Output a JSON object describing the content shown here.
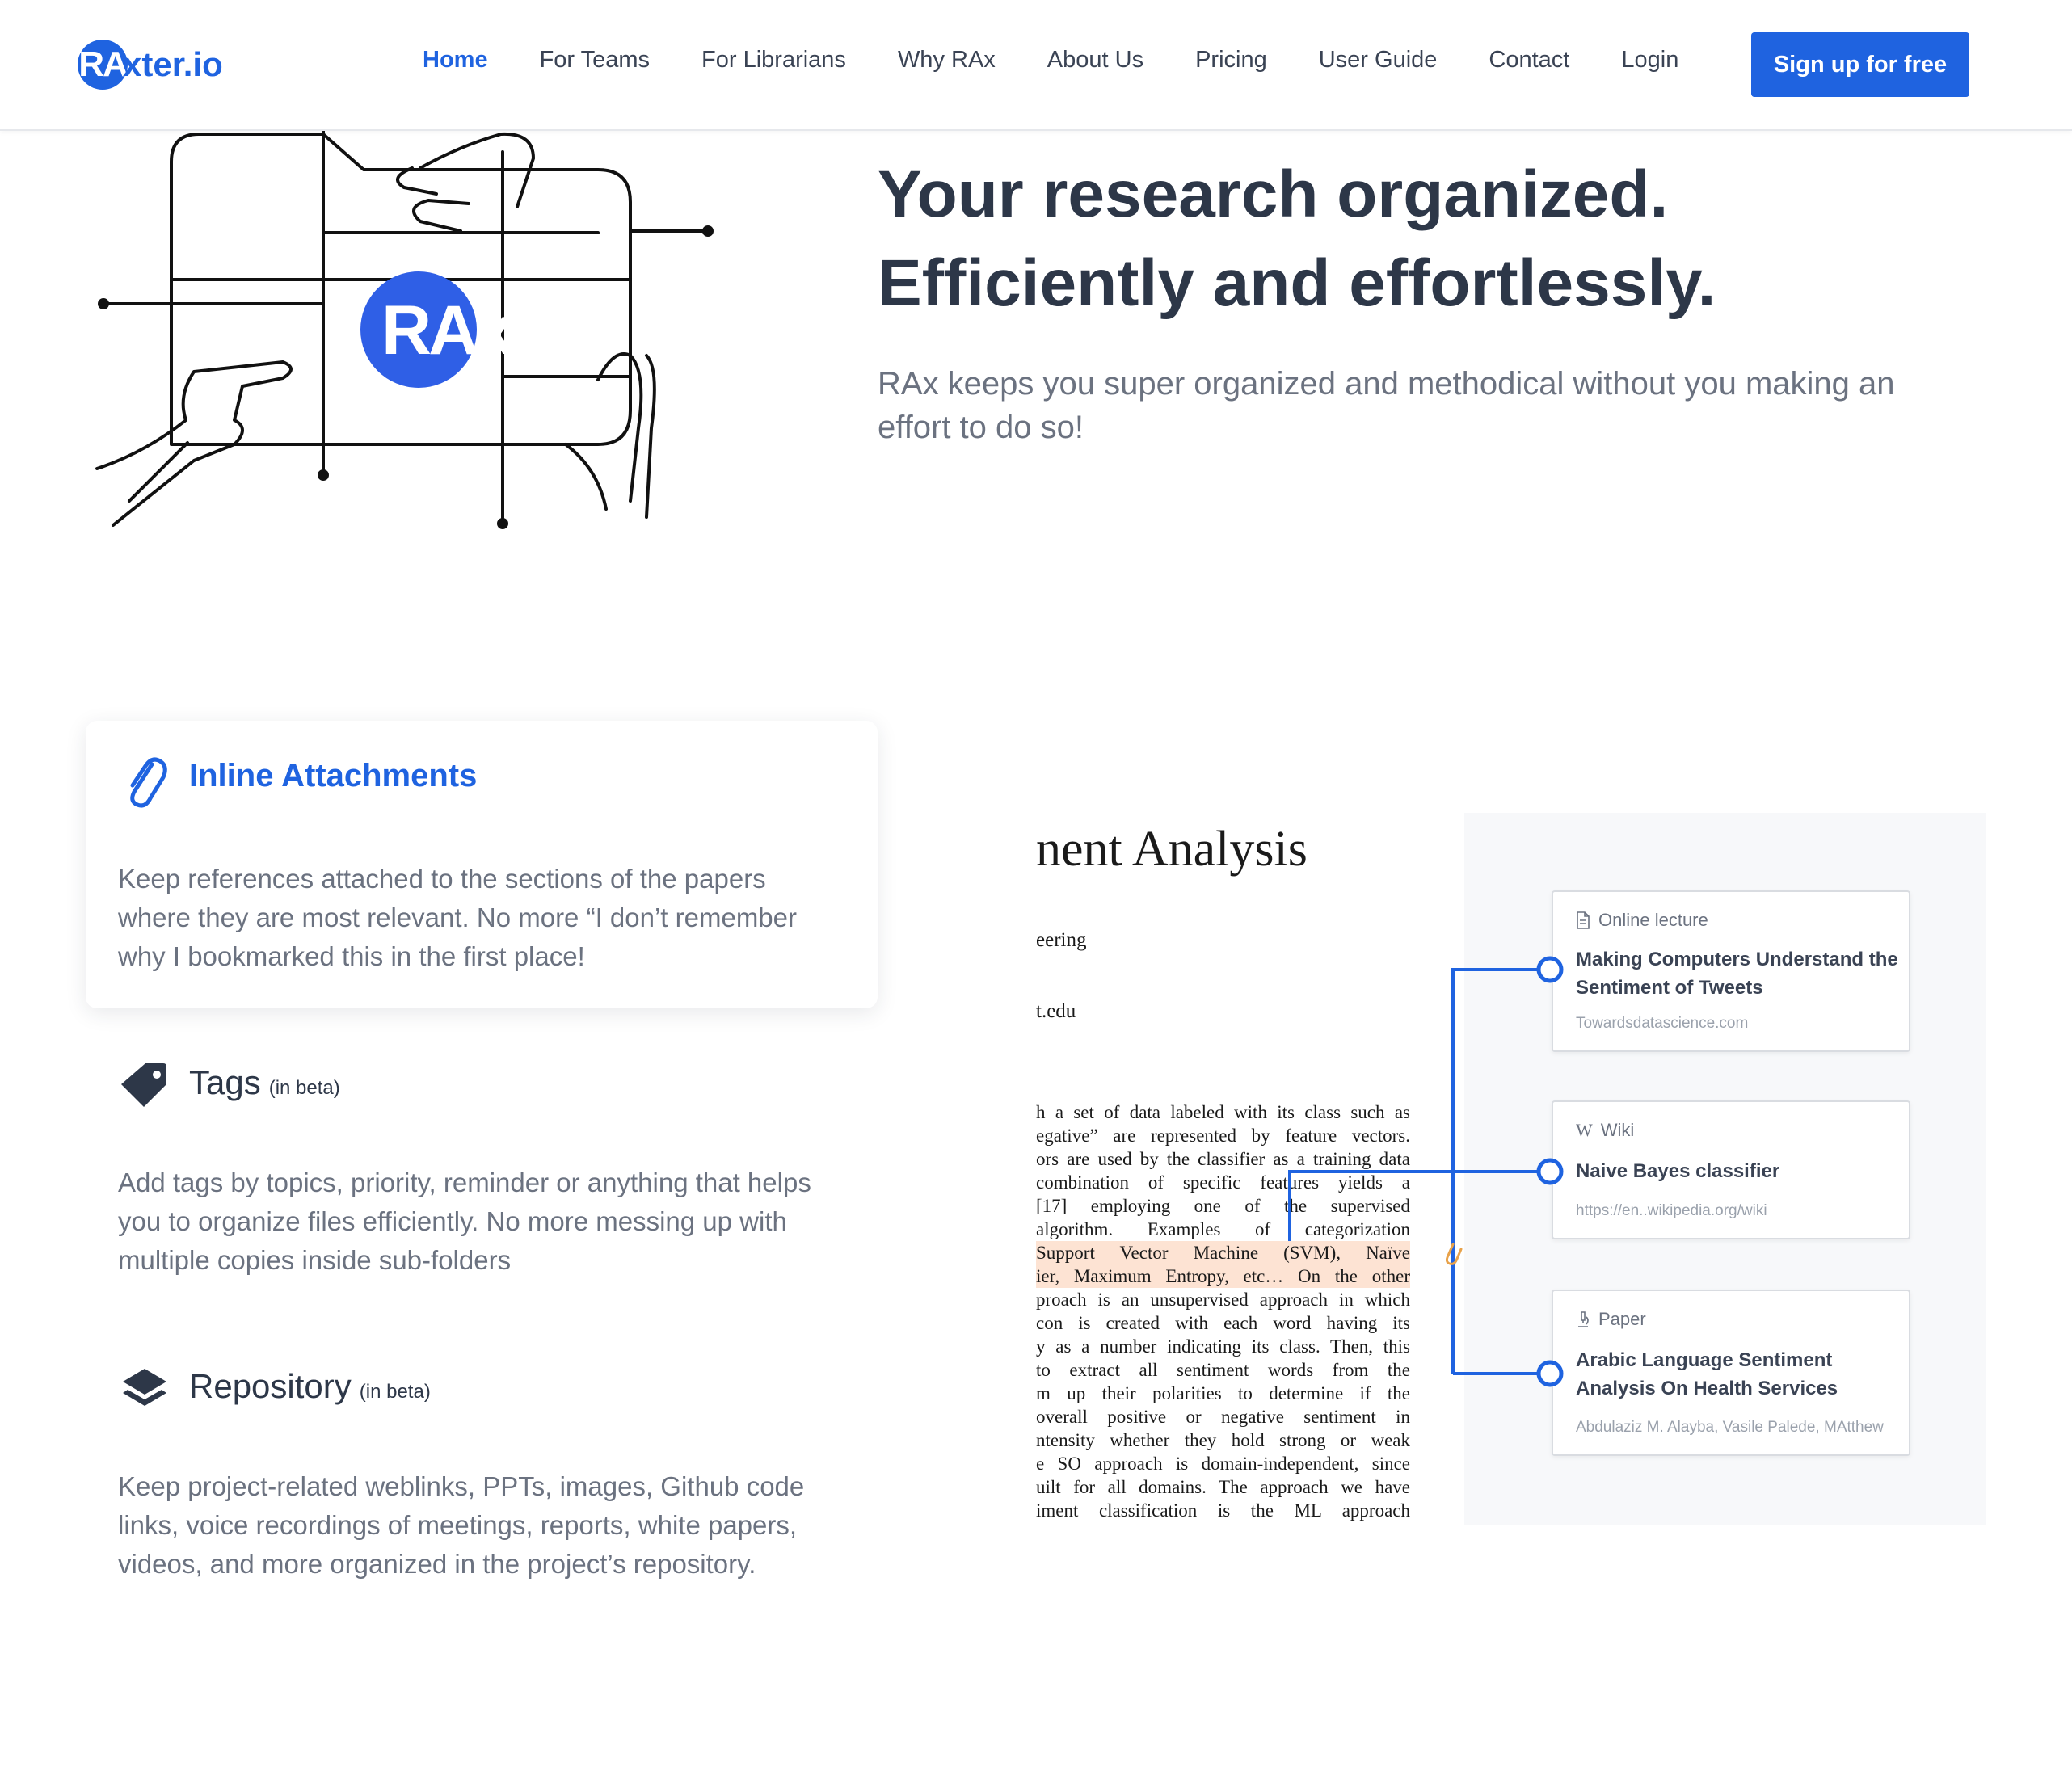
{
  "nav": {
    "logo_mark": "RA",
    "logo_rest": "xter.io",
    "links": [
      "Home",
      "For Teams",
      "For Librarians",
      "Why RAx",
      "About Us",
      "Pricing",
      "User Guide",
      "Contact",
      "Login"
    ],
    "signup_label": "Sign up for free",
    "accent": "#1f63e0"
  },
  "hero": {
    "illustration_logo": "RAx",
    "title_line1": "Your research organized.",
    "title_line2": "Efficiently and effortlessly.",
    "subtitle": "RAx keeps you super organized and methodical without you making an effort to do so!"
  },
  "features": [
    {
      "icon": "paperclip-icon",
      "title": "Inline Attachments",
      "beta": "",
      "description": "Keep references attached to the sections of the papers where they are most relevant. No more “I don’t remember why I bookmarked this in the first place!"
    },
    {
      "icon": "tag-icon",
      "title": "Tags",
      "beta": "(in beta)",
      "description": "Add tags by topics, priority, reminder or anything that helps you to organize files efficiently. No more messing up with multiple copies inside sub-folders"
    },
    {
      "icon": "layers-icon",
      "title": "Repository",
      "beta": "(in beta)",
      "description": "Keep project-related weblinks, PPTs, images, Github code links, voice recordings of meetings, reports, white papers, videos, and more organized in the project’s repository."
    }
  ],
  "demo": {
    "paper_title": "nent Analysis",
    "paper_line1": "eering",
    "paper_line2": "t.edu",
    "paper_lines": [
      "h a set of data labeled with its class such as",
      "egative” are represented by feature vectors.",
      "ors are used by the classifier as a training data",
      " combination of specific features yields a",
      "[17] employing one of the supervised",
      "algorithm. Examples of categorization",
      " Support Vector Machine (SVM), Naïve",
      "ier, Maximum Entropy, etc… On the other",
      "proach is an unsupervised approach in which",
      "con is created with each word having its",
      "y as a number indicating its class. Then, this",
      " to extract all sentiment words from the",
      "m up their polarities to determine if the",
      " overall positive or negative sentiment in",
      "ntensity whether they hold strong or weak",
      "e SO approach is domain-independent, since",
      "uilt for all domains. The approach we have",
      "iment classification is the ML approach"
    ],
    "references": [
      {
        "type": "Online lecture",
        "icon": "document-icon",
        "title": "Making Computers Understand the Sentiment of Tweets",
        "source": "Towardsdatascience.com"
      },
      {
        "type": "Wiki",
        "icon": "wikipedia-icon",
        "title": "Naive Bayes classifier",
        "source": "https://en..wikipedia.org/wiki"
      },
      {
        "type": "Paper",
        "icon": "microscope-icon",
        "title": "Arabic Language Sentiment Analysis On Health Services",
        "source": "Abdulaziz M. Alayba, Vasile Palede, MAtthew"
      }
    ]
  }
}
